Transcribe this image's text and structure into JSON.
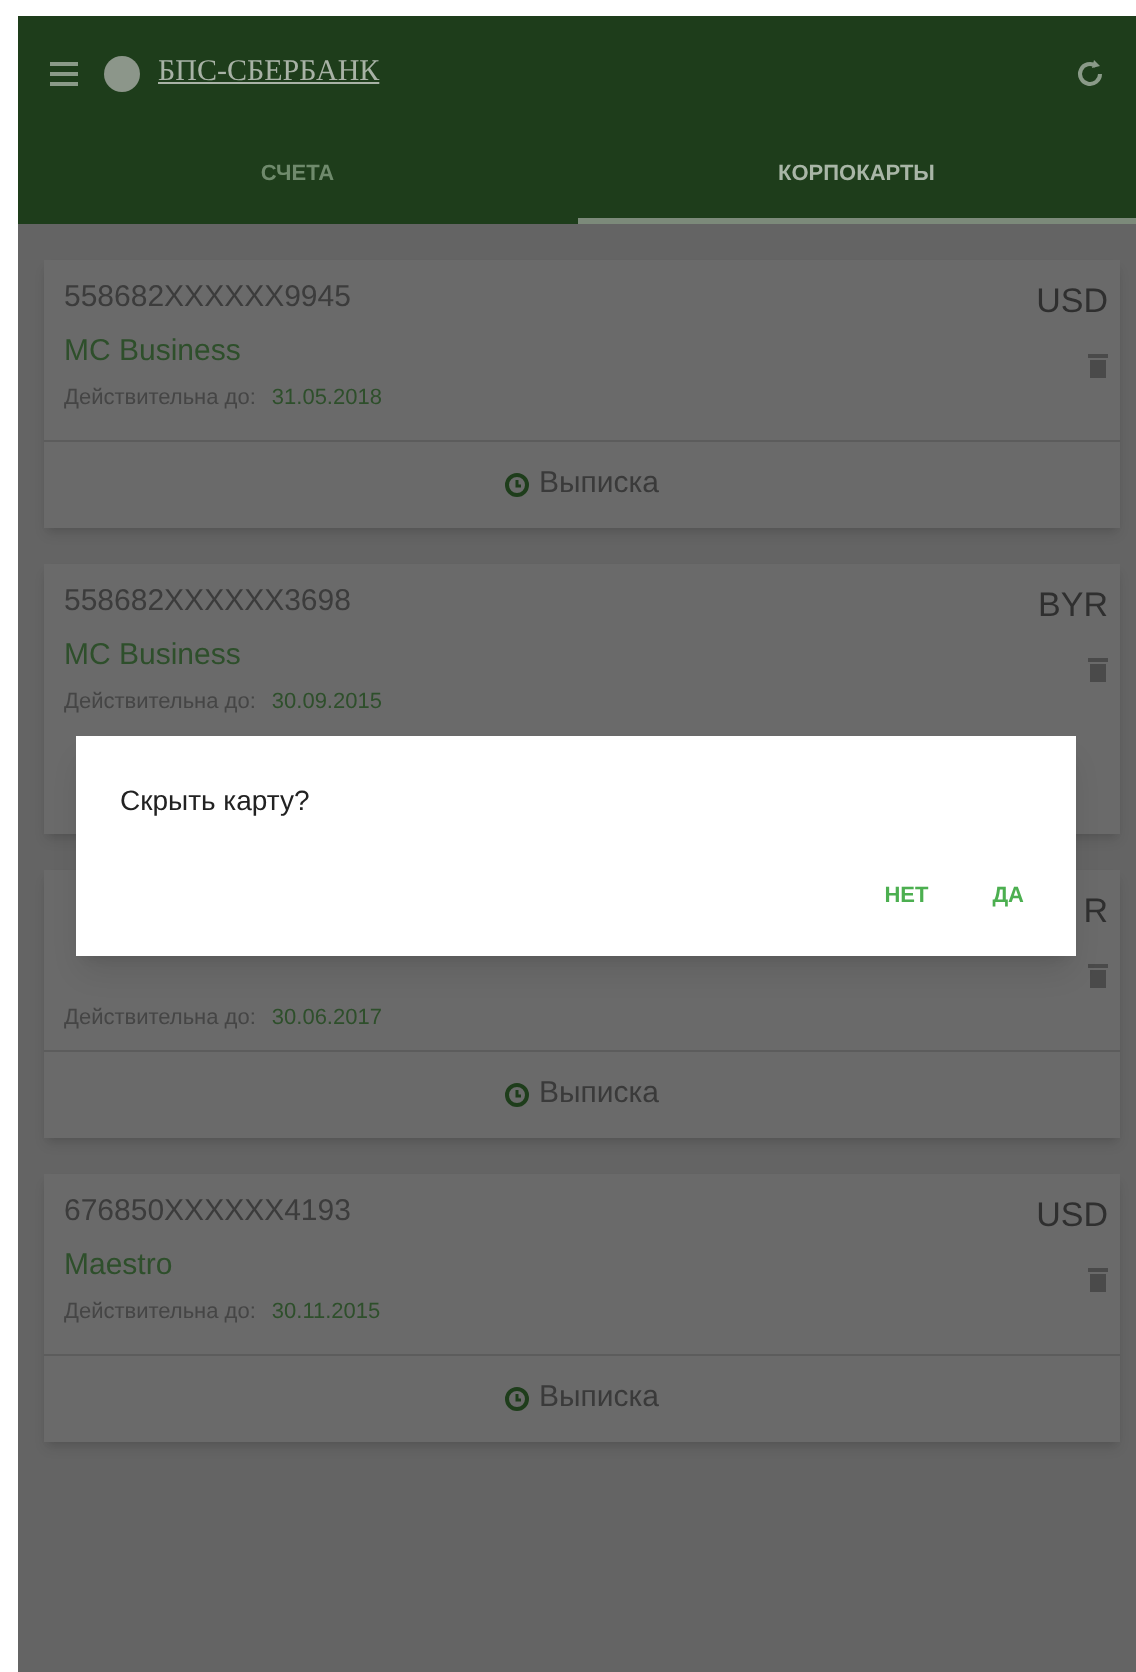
{
  "app_bar": {
    "brand": "БПС-СБЕРБАНК"
  },
  "tabs": [
    {
      "label": "СЧЕТА",
      "selected": false
    },
    {
      "label": "КОРПОКАРТЫ",
      "selected": true
    }
  ],
  "cards": [
    {
      "number": "558682XXXXXX9945",
      "currency": "USD",
      "name": "MC Business",
      "valid_label": "Действительна до:",
      "valid_date": "31.05.2018",
      "statement": "Выписка"
    },
    {
      "number": "558682XXXXXX3698",
      "currency": "BYR",
      "name": "MC Business",
      "valid_label": "Действительна до:",
      "valid_date": "30.09.2015"
    },
    {
      "currency": "R",
      "valid_label": "Действительна до:",
      "valid_date": "30.06.2017",
      "statement": "Выписка"
    },
    {
      "number": "676850XXXXXX4193",
      "currency": "USD",
      "name": "Maestro",
      "valid_label": "Действительна до:",
      "valid_date": "30.11.2015",
      "statement": "Выписка"
    }
  ],
  "dialog": {
    "message": "Скрыть карту?",
    "buttons": [
      "НЕТ",
      "ДА"
    ]
  }
}
